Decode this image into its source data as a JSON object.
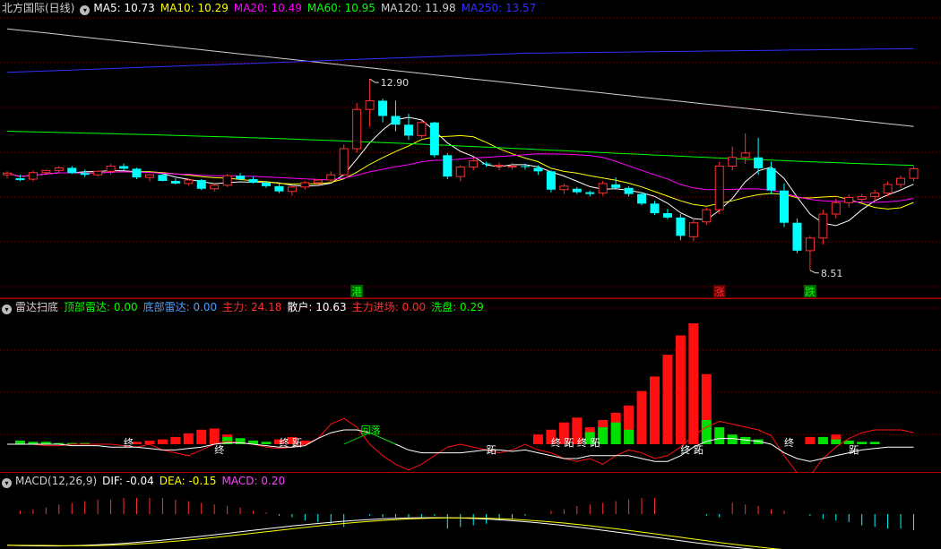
{
  "main": {
    "title": "北方国际(日线)",
    "ma": [
      {
        "label": "MA5: 10.73",
        "color": "#ffffff"
      },
      {
        "label": "MA10: 10.29",
        "color": "#ffff00"
      },
      {
        "label": "MA20: 10.49",
        "color": "#ff00ff"
      },
      {
        "label": "MA60: 10.95",
        "color": "#00ff00"
      },
      {
        "label": "MA120: 11.98",
        "color": "#d0d0d0"
      },
      {
        "label": "MA250: 13.57",
        "color": "#3030ff"
      }
    ],
    "high_label": "12.90",
    "low_label": "8.51",
    "signals": [
      {
        "text": "港",
        "color": "#00ff00",
        "bg": "#006000"
      },
      {
        "text": "涨",
        "color": "#ff3030",
        "bg": "#600000"
      },
      {
        "text": "跌",
        "color": "#00ff00",
        "bg": "#006000"
      }
    ]
  },
  "radar": {
    "title": "雷达扫底",
    "items": [
      {
        "label": "顶部雷达: 0.00",
        "color": "#00ff00"
      },
      {
        "label": "底部雷达: 0.00",
        "color": "#4aa0ff"
      },
      {
        "label": "主力: 24.18",
        "color": "#ff3030"
      },
      {
        "label": "散户: 10.63",
        "color": "#ffffff"
      },
      {
        "label": "主力进场: 0.00",
        "color": "#ff3030"
      },
      {
        "label": "洗盘: 0.29",
        "color": "#00ff00"
      }
    ],
    "annotations": [
      "终",
      "终",
      "终 跖",
      "跖",
      "终 跖 终 跖",
      "终 跖",
      "终",
      "跖"
    ],
    "box_label": "回落"
  },
  "macd": {
    "title": "MACD(12,26,9)",
    "items": [
      {
        "label": "DIF: -0.04",
        "color": "#ffffff"
      },
      {
        "label": "DEA: -0.15",
        "color": "#ffff00"
      },
      {
        "label": "MACD: 0.20",
        "color": "#ff40ff"
      }
    ]
  },
  "chart_data": {
    "type": "candlestick",
    "price_range": [
      8.3,
      14.3
    ],
    "candles": [
      [
        10.7,
        10.78,
        10.62,
        10.74
      ],
      [
        10.62,
        10.7,
        10.55,
        10.58
      ],
      [
        10.6,
        10.8,
        10.55,
        10.75
      ],
      [
        10.75,
        10.82,
        10.7,
        10.8
      ],
      [
        10.8,
        10.9,
        10.74,
        10.86
      ],
      [
        10.86,
        10.9,
        10.72,
        10.74
      ],
      [
        10.74,
        10.82,
        10.65,
        10.7
      ],
      [
        10.7,
        10.8,
        10.66,
        10.78
      ],
      [
        10.78,
        10.95,
        10.7,
        10.9
      ],
      [
        10.9,
        10.96,
        10.8,
        10.84
      ],
      [
        10.84,
        10.86,
        10.6,
        10.64
      ],
      [
        10.64,
        10.72,
        10.55,
        10.7
      ],
      [
        10.7,
        10.72,
        10.55,
        10.56
      ],
      [
        10.56,
        10.62,
        10.48,
        10.5
      ],
      [
        10.5,
        10.62,
        10.45,
        10.58
      ],
      [
        10.58,
        10.6,
        10.35,
        10.38
      ],
      [
        10.38,
        10.5,
        10.32,
        10.46
      ],
      [
        10.46,
        10.72,
        10.42,
        10.68
      ],
      [
        10.68,
        10.74,
        10.58,
        10.6
      ],
      [
        10.6,
        10.66,
        10.5,
        10.52
      ],
      [
        10.52,
        10.56,
        10.4,
        10.44
      ],
      [
        10.44,
        10.5,
        10.28,
        10.32
      ],
      [
        10.32,
        10.46,
        10.22,
        10.42
      ],
      [
        10.42,
        10.56,
        10.36,
        10.52
      ],
      [
        10.52,
        10.6,
        10.46,
        10.58
      ],
      [
        10.58,
        10.78,
        10.52,
        10.7
      ],
      [
        10.7,
        11.4,
        10.66,
        11.3
      ],
      [
        11.3,
        12.35,
        11.2,
        12.2
      ],
      [
        12.2,
        12.9,
        11.8,
        12.4
      ],
      [
        12.4,
        12.45,
        11.9,
        12.05
      ],
      [
        12.05,
        12.4,
        11.7,
        11.85
      ],
      [
        11.85,
        12.1,
        11.5,
        11.6
      ],
      [
        11.6,
        11.95,
        11.55,
        11.9
      ],
      [
        11.9,
        11.92,
        11.1,
        11.15
      ],
      [
        11.15,
        11.2,
        10.6,
        10.66
      ],
      [
        10.66,
        10.92,
        10.55,
        10.88
      ],
      [
        10.88,
        11.1,
        10.8,
        11.02
      ],
      [
        10.96,
        11.0,
        10.88,
        10.94
      ],
      [
        10.9,
        10.98,
        10.8,
        10.92
      ],
      [
        10.88,
        10.98,
        10.82,
        10.9
      ],
      [
        10.9,
        10.96,
        10.82,
        10.88
      ],
      [
        10.86,
        10.92,
        10.7,
        10.78
      ],
      [
        10.78,
        10.8,
        10.3,
        10.36
      ],
      [
        10.36,
        10.5,
        10.26,
        10.44
      ],
      [
        10.38,
        10.42,
        10.26,
        10.3
      ],
      [
        10.3,
        10.34,
        10.2,
        10.26
      ],
      [
        10.28,
        10.56,
        10.22,
        10.5
      ],
      [
        10.48,
        10.64,
        10.36,
        10.4
      ],
      [
        10.4,
        10.44,
        10.2,
        10.26
      ],
      [
        10.26,
        10.3,
        10.0,
        10.04
      ],
      [
        10.04,
        10.1,
        9.78,
        9.82
      ],
      [
        9.82,
        9.92,
        9.68,
        9.72
      ],
      [
        9.72,
        9.8,
        9.2,
        9.3
      ],
      [
        9.28,
        9.7,
        9.18,
        9.6
      ],
      [
        9.62,
        9.95,
        9.55,
        9.9
      ],
      [
        9.9,
        11.0,
        9.8,
        10.9
      ],
      [
        10.9,
        11.35,
        10.8,
        11.1
      ],
      [
        11.1,
        11.65,
        10.95,
        11.2
      ],
      [
        11.1,
        11.55,
        10.7,
        10.85
      ],
      [
        10.85,
        11.0,
        10.25,
        10.34
      ],
      [
        10.34,
        10.5,
        9.5,
        9.6
      ],
      [
        9.6,
        9.7,
        8.9,
        8.96
      ],
      [
        8.96,
        9.3,
        8.51,
        9.25
      ],
      [
        9.25,
        9.9,
        9.1,
        9.8
      ],
      [
        9.8,
        10.15,
        9.7,
        10.06
      ],
      [
        10.06,
        10.25,
        9.95,
        10.18
      ],
      [
        10.14,
        10.26,
        10.05,
        10.2
      ],
      [
        10.2,
        10.36,
        10.1,
        10.28
      ],
      [
        10.28,
        10.55,
        10.2,
        10.48
      ],
      [
        10.48,
        10.68,
        10.4,
        10.62
      ],
      [
        10.62,
        10.9,
        10.55,
        10.84
      ]
    ],
    "ma_lines": {
      "MA5": {
        "color": "#ffffff"
      },
      "MA10": {
        "color": "#ffff00"
      },
      "MA20": {
        "color": "#ff00ff"
      },
      "MA60": {
        "color": "#00ff00"
      },
      "MA120": {
        "color": "#d0d0d0"
      },
      "MA250": {
        "color": "#3030ff"
      }
    }
  }
}
